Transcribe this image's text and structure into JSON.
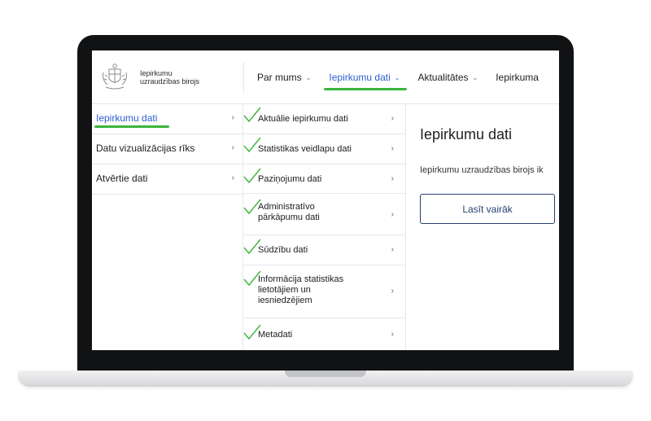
{
  "header": {
    "org_line1": "Iepirkumu",
    "org_line2": "uzraudzības birojs",
    "nav": [
      {
        "label": "Par mums"
      },
      {
        "label": "Iepirkumu dati"
      },
      {
        "label": "Aktualitātes"
      },
      {
        "label": "Iepirkuma"
      }
    ]
  },
  "col1": {
    "items": [
      {
        "label": "Iepirkumu dati"
      },
      {
        "label": "Datu vizualizācijas rīks"
      },
      {
        "label": "Atvērtie dati"
      }
    ]
  },
  "col2": {
    "items": [
      {
        "label": "Aktuālie iepirkumu dati"
      },
      {
        "label": "Statistikas veidlapu dati"
      },
      {
        "label": "Paziņojumu dati"
      },
      {
        "label": "Administratīvo pārkāpumu dati"
      },
      {
        "label": "Sūdzību dati"
      },
      {
        "label": "Informācija statistikas lietotājiem un iesniedzējiem"
      },
      {
        "label": "Metadati"
      }
    ]
  },
  "col3": {
    "title": "Iepirkumu dati",
    "description": "Iepirkumu uzraudzības birojs ik",
    "button": "Lasīt vairāk"
  },
  "icons": {
    "chevron": "›",
    "dropdown": "⌄"
  },
  "colors": {
    "accent": "#2f5fd0",
    "highlight": "#3cb43c",
    "button_border": "#24406e"
  }
}
